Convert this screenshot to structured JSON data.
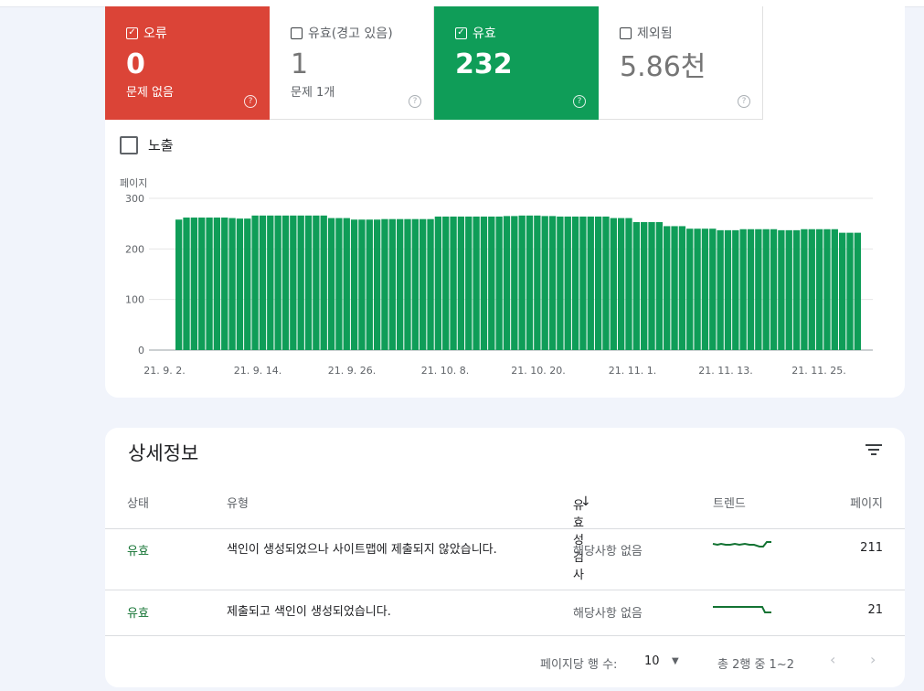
{
  "summary": {
    "tiles": [
      {
        "key": "error",
        "label": "오류",
        "value": "0",
        "sub": "문제 없음",
        "checked": true
      },
      {
        "key": "warn",
        "label": "유효(경고 있음)",
        "value": "1",
        "sub": "문제 1개",
        "checked": false
      },
      {
        "key": "valid",
        "label": "유효",
        "value": "232",
        "sub": "",
        "checked": true
      },
      {
        "key": "excluded",
        "label": "제외됨",
        "value": "5.86천",
        "sub": "",
        "checked": false
      }
    ],
    "help_glyph": "?",
    "check_glyph": "✓"
  },
  "impressions": {
    "label": "노출"
  },
  "chart_data": {
    "type": "bar",
    "ylabel": "페이지",
    "ylim": [
      0,
      300
    ],
    "yticks": [
      "300",
      "200",
      "100",
      "0"
    ],
    "xtick_labels": [
      "21. 9. 2.",
      "21. 9. 14.",
      "21. 9. 26.",
      "21. 10. 8.",
      "21. 10. 20.",
      "21. 11. 1.",
      "21. 11. 13.",
      "21. 11. 25."
    ],
    "color": "#0f9d58",
    "values": [
      258,
      262,
      262,
      262,
      262,
      262,
      262,
      261,
      260,
      260,
      266,
      266,
      266,
      266,
      266,
      266,
      266,
      266,
      266,
      266,
      261,
      261,
      261,
      258,
      258,
      258,
      258,
      259,
      259,
      259,
      259,
      259,
      259,
      259,
      264,
      264,
      264,
      264,
      264,
      264,
      264,
      264,
      264,
      265,
      265,
      266,
      266,
      266,
      265,
      265,
      264,
      264,
      264,
      264,
      264,
      264,
      264,
      261,
      261,
      261,
      253,
      253,
      253,
      253,
      245,
      245,
      245,
      240,
      240,
      240,
      240,
      237,
      237,
      237,
      239,
      239,
      239,
      239,
      239,
      237,
      237,
      237,
      239,
      239,
      239,
      239,
      239,
      232,
      232,
      232
    ]
  },
  "details": {
    "title": "상세정보",
    "headers": {
      "status": "상태",
      "type": "유형",
      "validation": "유효성 검사",
      "trend": "트렌드",
      "pages": "페이지"
    },
    "sort_arrow": "↓",
    "rows": [
      {
        "status": "유효",
        "type": "색인이 생성되었으나 사이트맵에 제출되지 않았습니다.",
        "validation": "해당사항 없음",
        "pages": "211"
      },
      {
        "status": "유효",
        "type": "제출되고 색인이 생성되었습니다.",
        "validation": "해당사항 없음",
        "pages": "21"
      }
    ],
    "pager": {
      "rows_per_page_label": "페이지당 행 수:",
      "rows_per_page": "10",
      "caret": "▼",
      "range": "총 2행 중 1~2",
      "prev": "‹",
      "next": "›"
    }
  }
}
